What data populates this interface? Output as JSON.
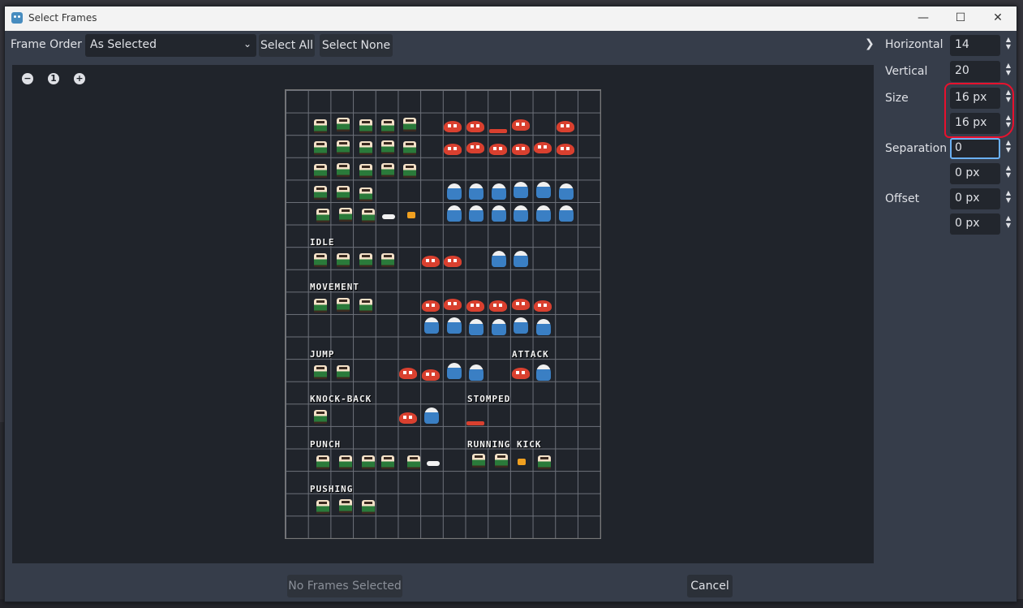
{
  "window": {
    "title": "Select Frames",
    "controls": {
      "minimize": "—",
      "maximize": "☐",
      "close": "✕"
    }
  },
  "toolbar": {
    "frame_order_label": "Frame Order",
    "frame_order_value": "As Selected",
    "select_all": "Select All",
    "select_none": "Select None",
    "expand": "❯"
  },
  "viewer": {
    "zoom_out": "−",
    "zoom_reset": "1",
    "zoom_in": "+",
    "sheet_labels": {
      "idle": "IDLE",
      "movement": "MOVEMENT",
      "jump": "JUMP",
      "attack": "ATTACK",
      "knockback": "KNOCK-BACK",
      "stomped": "STOMPED",
      "punch": "PUNCH",
      "running_kick": "RUNNING KICK",
      "pushing": "PUSHING"
    }
  },
  "settings": {
    "horizontal_label": "Horizontal",
    "horizontal_value": "14",
    "vertical_label": "Vertical",
    "vertical_value": "20",
    "size_label": "Size",
    "size_x": "16 px",
    "size_y": "16 px",
    "separation_label": "Separation",
    "separation_x": "0",
    "separation_y": "0 px",
    "offset_label": "Offset",
    "offset_x": "0 px",
    "offset_y": "0 px"
  },
  "footer": {
    "status_button": "No Frames Selected",
    "cancel": "Cancel"
  },
  "colors": {
    "annotation": "#e8112d",
    "focus": "#6ab0f3"
  }
}
